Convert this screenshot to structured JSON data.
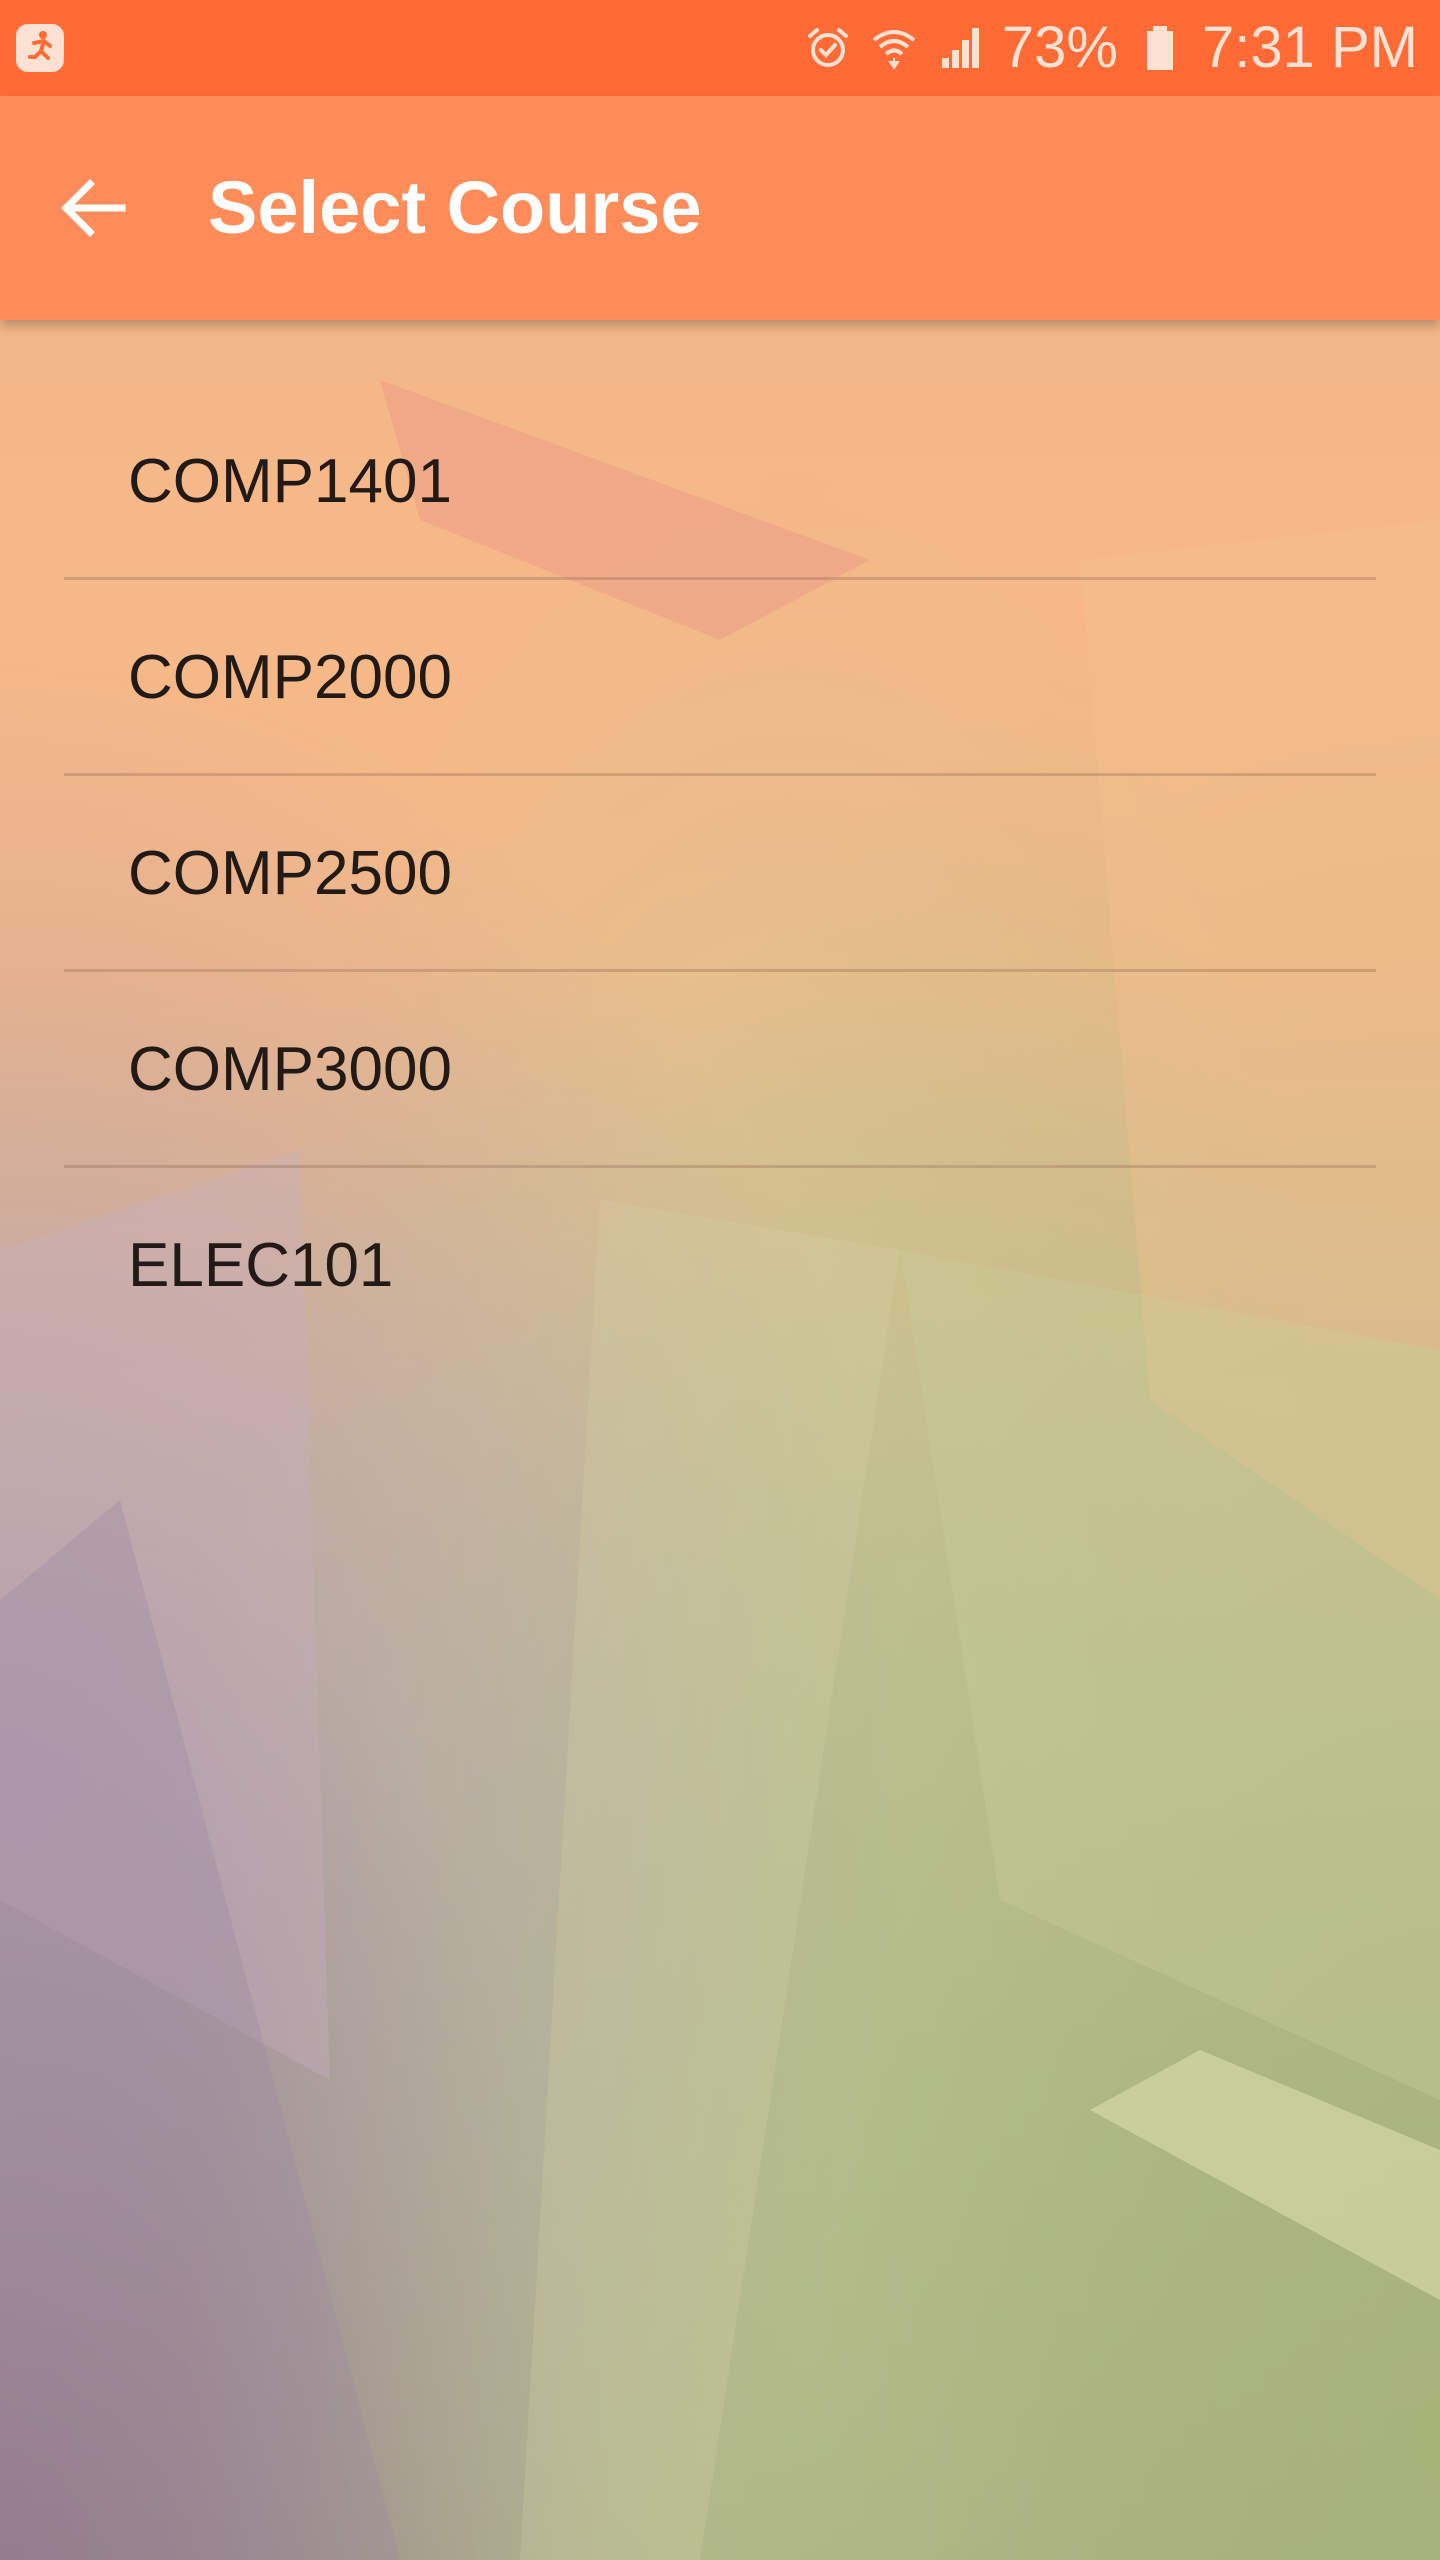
{
  "status_bar": {
    "app_icon": "running-person-icon",
    "alarm_icon": "alarm-icon",
    "wifi_icon": "wifi-icon",
    "signal_icon": "signal-icon",
    "battery_percent": "73%",
    "battery_icon": "battery-icon",
    "time": "7:31 PM"
  },
  "app_bar": {
    "back_icon": "arrow-back-icon",
    "title": "Select Course",
    "color": "#ff8c59"
  },
  "courses": [
    {
      "code": "COMP1401"
    },
    {
      "code": "COMP2000"
    },
    {
      "code": "COMP2500"
    },
    {
      "code": "COMP3000"
    },
    {
      "code": "ELEC101"
    }
  ],
  "colors": {
    "status_bar": "#ff6a35",
    "app_bar": "#ff8c59",
    "list_text": "#221a16"
  }
}
